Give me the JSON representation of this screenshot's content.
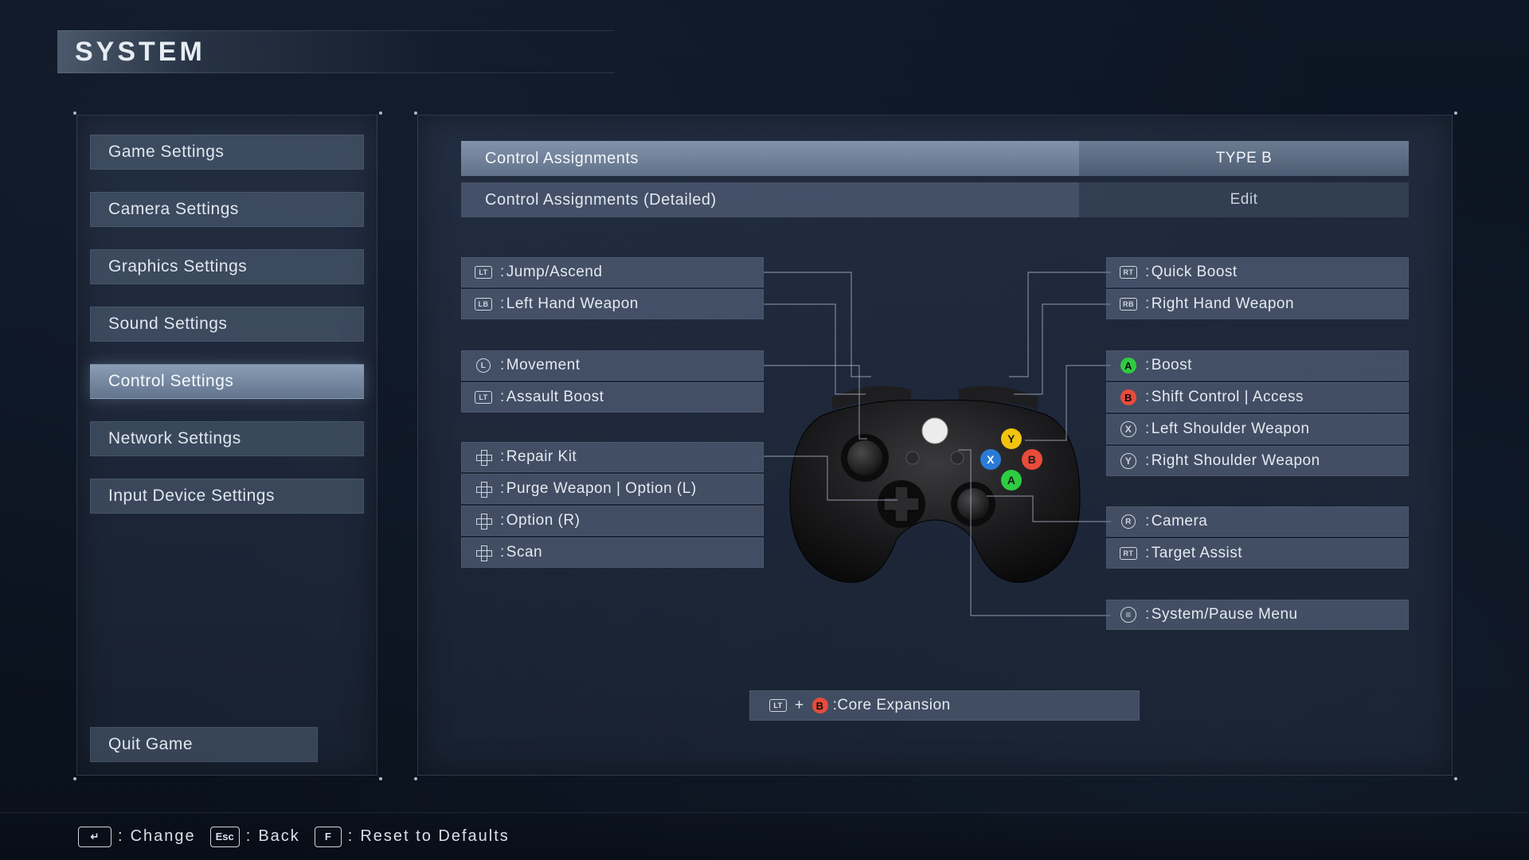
{
  "header": {
    "title": "SYSTEM"
  },
  "sidebar": {
    "items": [
      {
        "label": "Game Settings",
        "selected": false
      },
      {
        "label": "Camera Settings",
        "selected": false
      },
      {
        "label": "Graphics Settings",
        "selected": false
      },
      {
        "label": "Sound Settings",
        "selected": false
      },
      {
        "label": "Control Settings",
        "selected": true
      },
      {
        "label": "Network Settings",
        "selected": false
      },
      {
        "label": "Input Device Settings",
        "selected": false
      }
    ],
    "quit_label": "Quit Game"
  },
  "top_options": [
    {
      "label": "Control Assignments",
      "value": "TYPE B",
      "highlight": true
    },
    {
      "label": "Control Assignments (Detailed)",
      "value": "Edit",
      "highlight": false
    }
  ],
  "mappings": {
    "left": [
      {
        "glyph": "LT",
        "kind": "box",
        "label": "Jump/Ascend"
      },
      {
        "glyph": "LB",
        "kind": "box",
        "label": "Left Hand Weapon"
      },
      {
        "glyph": "L",
        "kind": "stick",
        "label": "Movement"
      },
      {
        "glyph": "LT",
        "kind": "box",
        "label": "Assault Boost"
      },
      {
        "glyph": "",
        "kind": "dpad",
        "label": "Repair Kit"
      },
      {
        "glyph": "",
        "kind": "dpad",
        "label": "Purge Weapon | Option (L)"
      },
      {
        "glyph": "",
        "kind": "dpad",
        "label": "Option (R)"
      },
      {
        "glyph": "",
        "kind": "dpad",
        "label": "Scan"
      }
    ],
    "right": [
      {
        "glyph": "RT",
        "kind": "box",
        "label": "Quick Boost"
      },
      {
        "glyph": "RB",
        "kind": "box",
        "label": "Right Hand Weapon"
      },
      {
        "glyph": "A",
        "kind": "face",
        "faceClass": "btn-a",
        "label": "Boost"
      },
      {
        "glyph": "B",
        "kind": "face",
        "faceClass": "btn-b",
        "label": "Shift Control | Access"
      },
      {
        "glyph": "X",
        "kind": "circle",
        "label": "Left Shoulder Weapon"
      },
      {
        "glyph": "Y",
        "kind": "circle",
        "label": "Right Shoulder Weapon"
      },
      {
        "glyph": "R",
        "kind": "stick",
        "label": "Camera"
      },
      {
        "glyph": "RT",
        "kind": "box",
        "label": "Target Assist"
      },
      {
        "glyph": "≡",
        "kind": "circle",
        "label": "System/Pause Menu"
      }
    ],
    "combo": {
      "icon1_glyph": "LT",
      "icon1_kind": "box",
      "plus": "+",
      "icon2_glyph": "B",
      "icon2_kind": "face",
      "icon2_faceClass": "btn-b",
      "label": "Core Expansion"
    }
  },
  "footer": {
    "hints": [
      {
        "key": "↵",
        "label": "Change"
      },
      {
        "key": "Esc",
        "label": "Back"
      },
      {
        "key": "F",
        "label": "Reset to Defaults"
      }
    ]
  },
  "colors": {
    "accent": "#8fa3bd",
    "panel": "#2d3a52",
    "text": "#dfe6ef"
  }
}
